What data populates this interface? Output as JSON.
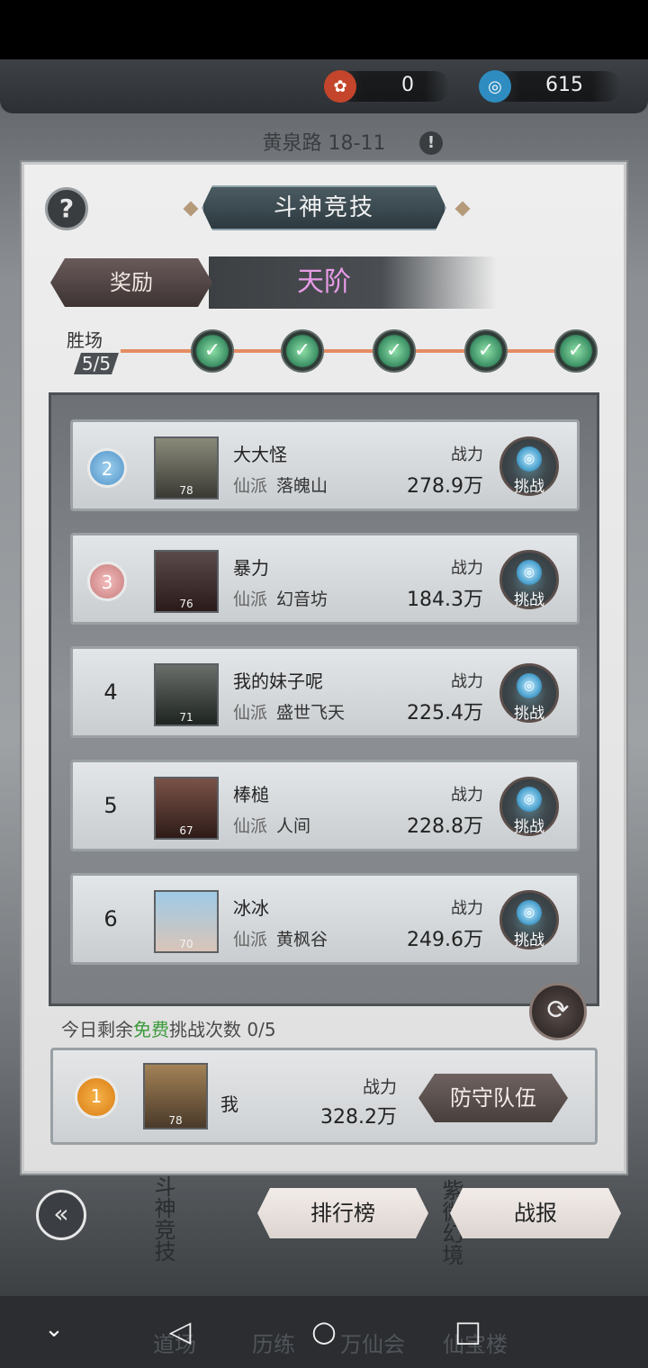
{
  "header": {
    "currency_a": {
      "icon": "red-token-icon",
      "value": "0",
      "color": "#d2553a"
    },
    "currency_b": {
      "icon": "blue-spirit-icon",
      "value": "615",
      "color": "#3aa2d6"
    },
    "stage": "黄泉路 18-11"
  },
  "panel": {
    "help": "?",
    "title": "斗神竞技",
    "reward_tab": "奖励",
    "rank_tier": "天阶",
    "wins_label": "胜场",
    "wins_count": "5/5",
    "win_nodes": 5
  },
  "opponents": [
    {
      "rank": "2",
      "rank_style": "badge-blue",
      "name": "大大怪",
      "sect_label": "仙派",
      "sect": "落魄山",
      "level": "78",
      "power_label": "战力",
      "power": "278.9万",
      "action": "挑战"
    },
    {
      "rank": "3",
      "rank_style": "badge-red",
      "name": "暴力",
      "sect_label": "仙派",
      "sect": "幻音坊",
      "level": "76",
      "power_label": "战力",
      "power": "184.3万",
      "action": "挑战"
    },
    {
      "rank": "4",
      "rank_style": "plain",
      "name": "我的妹子呢",
      "sect_label": "仙派",
      "sect": "盛世飞天",
      "level": "71",
      "power_label": "战力",
      "power": "225.4万",
      "action": "挑战"
    },
    {
      "rank": "5",
      "rank_style": "plain",
      "name": "棒槌",
      "sect_label": "仙派",
      "sect": "人间",
      "level": "67",
      "power_label": "战力",
      "power": "228.8万",
      "action": "挑战"
    },
    {
      "rank": "6",
      "rank_style": "plain",
      "name": "冰冰",
      "sect_label": "仙派",
      "sect": "黄枫谷",
      "level": "70",
      "power_label": "战力",
      "power": "249.6万",
      "action": "挑战"
    }
  ],
  "free_attempts": {
    "prefix": "今日剩余",
    "free": "免费",
    "suffix": "挑战次数 0/5"
  },
  "me": {
    "rank": "1",
    "name": "我",
    "level": "78",
    "power_label": "战力",
    "power": "328.2万",
    "defense_button": "防守队伍"
  },
  "bottom": {
    "leaderboard": "排行榜",
    "battle_report": "战报",
    "vertical_left": "斗神竞技",
    "vertical_right": "紫微幻境"
  },
  "tabs": [
    "道场",
    "历练",
    "万仙会",
    "仙宝楼"
  ],
  "system_nav": [
    "back-icon",
    "home-icon",
    "recents-icon",
    "collapse-icon"
  ]
}
